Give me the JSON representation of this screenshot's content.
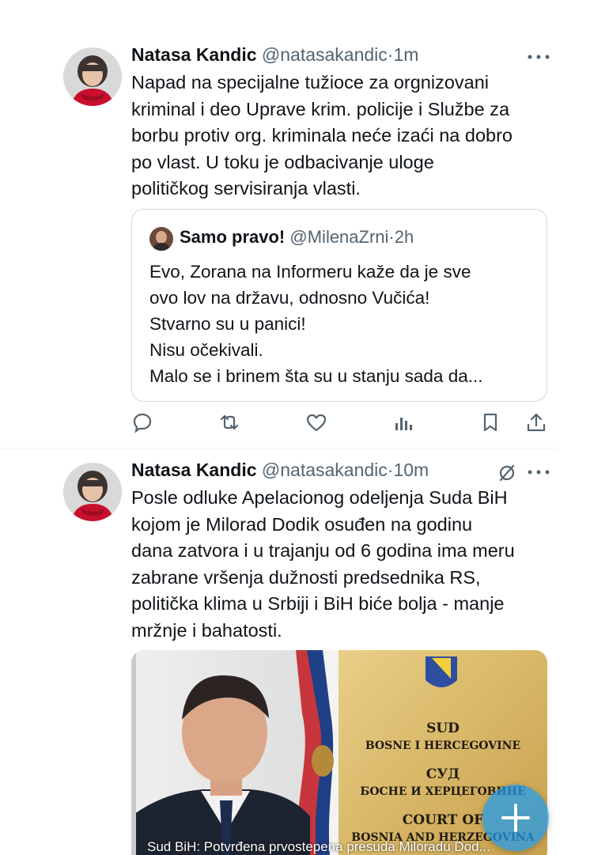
{
  "tweets": [
    {
      "name": "Natasa Kandic",
      "handle": "@natasakandic",
      "separator": "·",
      "time": "1m",
      "lines": [
        "Napad na specijalne tužioce za orgnizovani",
        "kriminal i deo Uprave krim. policije i Službe za",
        "borbu protiv org. kriminala neće izaći na dobro",
        "po vlast. U toku je odbacivanje uloge",
        "političkog servisiranja vlasti."
      ],
      "quote": {
        "name": "Samo pravo!",
        "handle": "@MilenaZrni",
        "separator": "·",
        "time": "2h",
        "lines": [
          "Evo, Zorana na Informeru kaže da je sve",
          "ovo lov na državu, odnosno Vučića!",
          "Stvarno su u panici!",
          "Nisu očekivali.",
          "Malo se i brinem šta su u stanju sada da..."
        ]
      },
      "actions": [
        "reply-icon",
        "retweet-icon",
        "like-icon",
        "views-icon",
        "bookmark-icon",
        "share-icon"
      ]
    },
    {
      "name": "Natasa Kandic",
      "handle": "@natasakandic",
      "separator": "·",
      "time": "10m",
      "lines": [
        "Posle odluke Apelacionog odeljenja Suda BiH",
        "kojom je Milorad Dodik osuđen na godinu",
        "dana zatvora i u trajanju od 6 godina ima meru",
        "zabrane vršenja dužnosti predsednika RS,",
        "politička klima u Srbiji i BiH biće bolja - manje",
        "mržnje i bahatosti."
      ],
      "media": {
        "sign_lines": [
          "SUD",
          "BOSNE I HERCEGOVINE",
          "СУД",
          "БОСНЕ И ХЕРЦЕГОВИНЕ",
          "COURT OF",
          "BOSNIA AND HERZEGOVINA"
        ],
        "caption": "Sud BiH: Potvrđena prvostepena presuda Miloradu Dod..."
      }
    }
  ],
  "colors": {
    "text": "#0f1419",
    "muted": "#536471",
    "border": "#cfd9de",
    "accent": "#1d9bf0",
    "avatar_scarf": "#c8102e"
  },
  "fab": {
    "icon": "plus-icon"
  }
}
